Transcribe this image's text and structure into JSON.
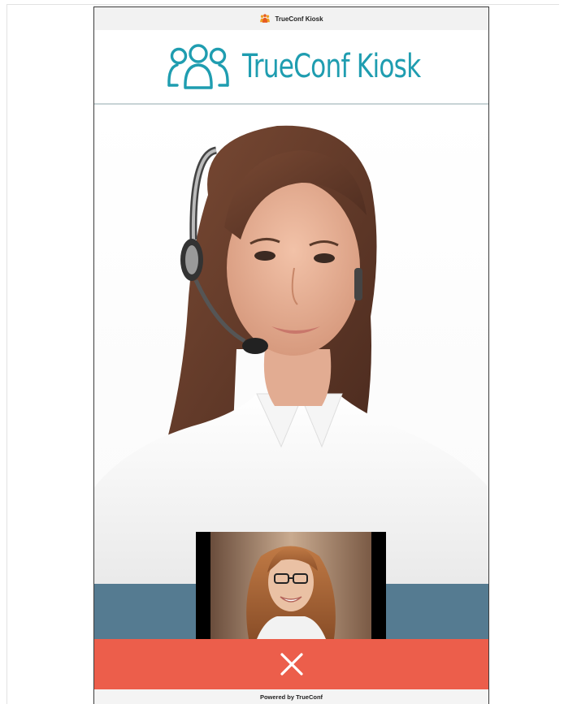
{
  "window": {
    "title": "TrueConf Kiosk",
    "title_icon": "trueconf-people-icon"
  },
  "logo": {
    "text": "TrueConf Kiosk",
    "icon": "trueconf-people-logo-icon",
    "color": "#1f9db0"
  },
  "call": {
    "remote_video": "operator-with-headset",
    "self_view": "local-camera-preview",
    "hangup_icon": "close-x-icon",
    "hangup_color": "#ec5e4b",
    "band_color": "#557b91"
  },
  "footer": {
    "text": "Powered by TrueConf"
  }
}
